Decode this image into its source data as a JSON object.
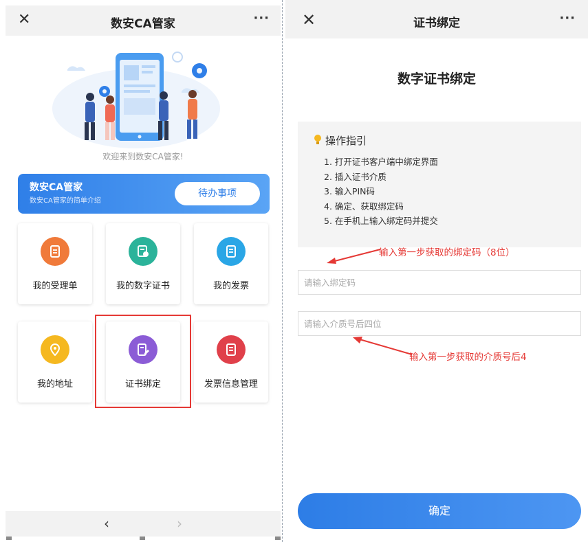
{
  "left_screen": {
    "title": "数安CA管家",
    "close_icon": "close-icon",
    "more_icon": "more-icon",
    "welcome_text": "欢迎来到数安CA管家!",
    "banner": {
      "title": "数安CA管家",
      "subtitle": "数安CA管家的简单介绍",
      "button_label": "待办事项"
    },
    "tiles": [
      {
        "label": "我的受理单",
        "icon": "clipboard-icon",
        "color": "#f07a3a"
      },
      {
        "label": "我的数字证书",
        "icon": "certificate-icon",
        "color": "#2bb39a"
      },
      {
        "label": "我的发票",
        "icon": "invoice-icon",
        "color": "#2aa6e6"
      },
      {
        "label": "我的地址",
        "icon": "location-icon",
        "color": "#f5b820"
      },
      {
        "label": "证书绑定",
        "icon": "edit-document-icon",
        "color": "#8b5cd6"
      },
      {
        "label": "发票信息管理",
        "icon": "invoice-manage-icon",
        "color": "#e0404a"
      }
    ],
    "nav": {
      "back": "‹",
      "forward": "›"
    }
  },
  "right_screen": {
    "title": "证书绑定",
    "heading": "数字证书绑定",
    "guide": {
      "title": "操作指引",
      "steps": [
        "1. 打开证书客户端中绑定界面",
        "2. 插入证书介质",
        "3. 输入PIN码",
        "4. 确定、获取绑定码",
        "5. 在手机上输入绑定码并提交"
      ]
    },
    "bind_code_placeholder": "请输入绑定码",
    "medium_placeholder": "请输入介质号后四位",
    "annotation_1": "输入第一步获取的绑定码（8位）",
    "annotation_2": "输入第一步获取的介质号后4",
    "confirm_label": "确定"
  },
  "colors": {
    "primary_blue": "#2f7fe8",
    "highlight_red": "#e53935"
  }
}
